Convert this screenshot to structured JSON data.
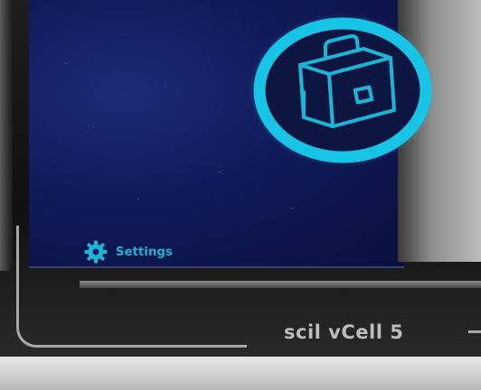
{
  "screen": {
    "menu": {
      "settings_label": "Settings",
      "settings_icon": "gear-icon",
      "selected_icon": "briefcase-icon"
    }
  },
  "device": {
    "brand_label": "scil vCell 5"
  },
  "colors": {
    "accent": "#1ab6d8",
    "screen_background": "#101a5a"
  }
}
